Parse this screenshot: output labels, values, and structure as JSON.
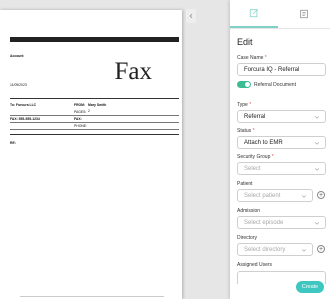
{
  "document": {
    "sender_label": "Account",
    "date_text": "11/09/2023",
    "to_company": "To: Forcura LLC",
    "from_label": "FROM:",
    "from_value": "Mary Smith",
    "pages_label": "PAGES:",
    "pages_value": "2",
    "fax_number": "FAX: 555-555-1234",
    "fax_label": "FAX:",
    "phone_label": "PHONE:",
    "re_label": "RE:",
    "title": "Fax"
  },
  "panel": {
    "tabs": [
      {
        "name": "edit",
        "icon": "edit-icon"
      },
      {
        "name": "notes",
        "icon": "notes-icon"
      }
    ],
    "heading": "Edit",
    "case_name": {
      "label": "Case Name",
      "value": "Forcura IQ - Referral"
    },
    "referral_toggle": {
      "label": "Referral Document",
      "on": true,
      "color": "#3bbd93"
    },
    "type": {
      "label": "Type",
      "value": "Referral"
    },
    "status": {
      "label": "Status",
      "value": "Attach to EMR"
    },
    "security_group": {
      "label": "Security Group",
      "placeholder": "Select"
    },
    "patient": {
      "label": "Patient",
      "placeholder": "Select patient"
    },
    "admission": {
      "label": "Admission",
      "placeholder": "Select episode"
    },
    "directory": {
      "label": "Directory",
      "placeholder": "Select directory"
    },
    "assigned_users": {
      "label": "Assigned Users"
    },
    "required_marker": "*",
    "add_symbol": "+",
    "create_button": "Create",
    "accent_color": "#3ec6c0"
  }
}
